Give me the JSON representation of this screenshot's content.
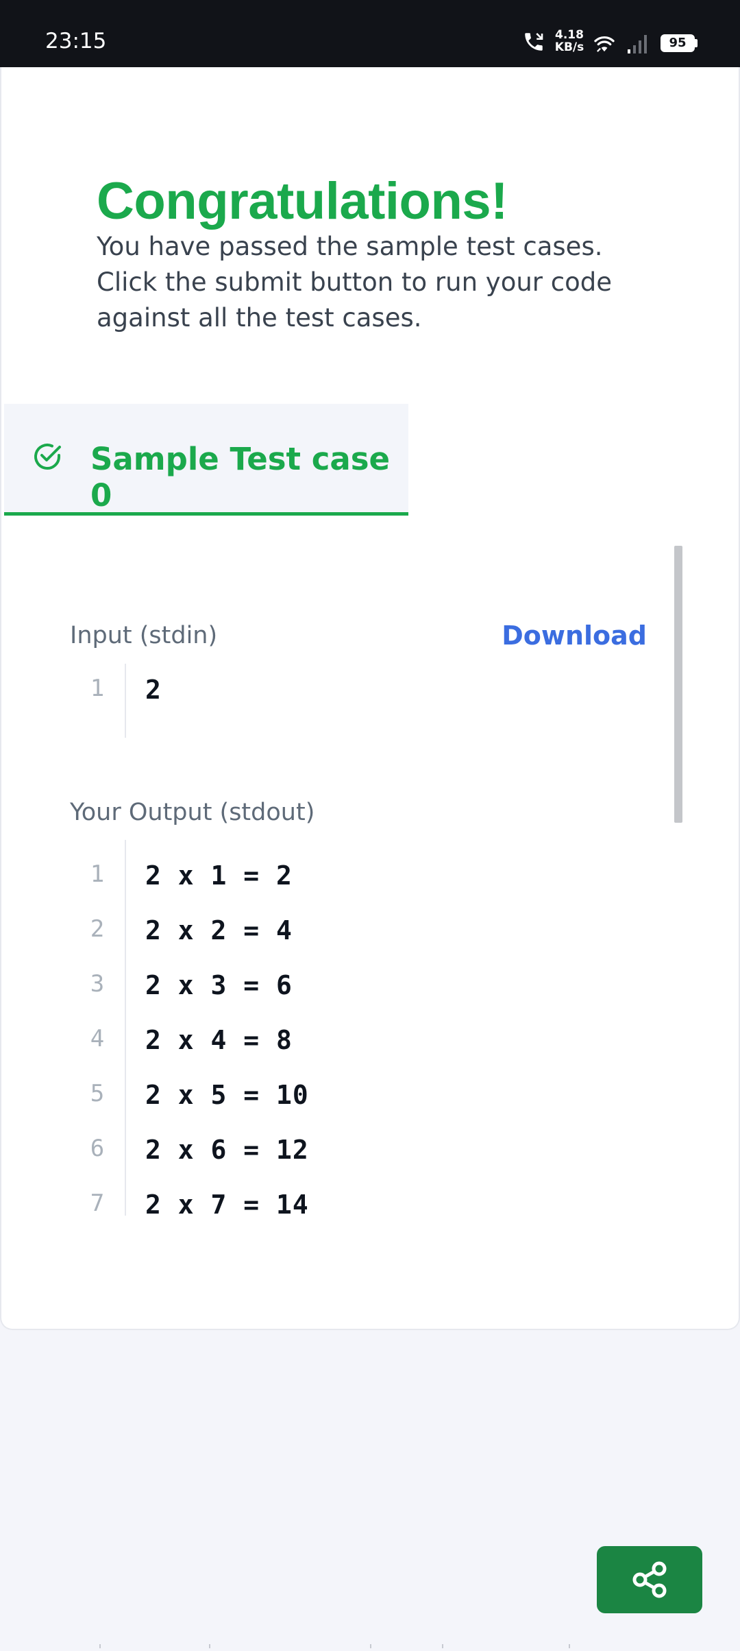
{
  "status_bar": {
    "time": "23:15",
    "net_speed_value": "4.18",
    "net_speed_unit": "KB/s",
    "battery": "95",
    "icons": [
      "call-icon",
      "wifi-icon",
      "signal-icon",
      "battery-icon"
    ]
  },
  "result": {
    "title": "Congratulations!",
    "message": "You have passed the sample test cases. Click the submit button to run your code against all the test cases."
  },
  "tabs": [
    {
      "label": "Sample Test case 0",
      "status": "passed",
      "icon": "check-circle-icon"
    }
  ],
  "input": {
    "label": "Input (stdin)",
    "download_label": "Download",
    "lines": [
      {
        "no": "1",
        "text": "2"
      }
    ]
  },
  "output": {
    "label": "Your Output (stdout)",
    "lines": [
      {
        "no": "1",
        "text": "2 x 1 = 2"
      },
      {
        "no": "2",
        "text": "2 x 2 = 4"
      },
      {
        "no": "3",
        "text": "2 x 3 = 6"
      },
      {
        "no": "4",
        "text": "2 x 4 = 8"
      },
      {
        "no": "5",
        "text": "2 x 5 = 10"
      },
      {
        "no": "6",
        "text": "2 x 6 = 12"
      },
      {
        "no": "7",
        "text": "2 x 7 = 14"
      }
    ]
  },
  "share_button": {
    "icon": "share-icon"
  },
  "colors": {
    "success": "#1ba94c",
    "link": "#3b6de0",
    "share_button": "#1b8543",
    "status_bar": "#111318"
  }
}
